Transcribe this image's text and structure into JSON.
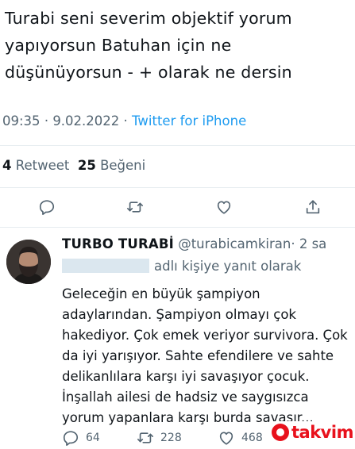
{
  "main_tweet": {
    "text": "Turabi seni severim objektif yorum\nyapıyorsun Batuhan için ne\ndüşünüyorsun - + olarak ne dersin",
    "time": "09:35",
    "date": "9.02.2022",
    "separator": "·",
    "client": "Twitter for iPhone"
  },
  "stats": {
    "retweet_count": "4",
    "retweet_label": "Retweet",
    "like_count": "25",
    "like_label": "Beğeni"
  },
  "actions": {
    "icons": [
      "reply-icon",
      "retweet-icon",
      "like-icon",
      "share-icon"
    ]
  },
  "reply": {
    "name": "TURBO TURABİ",
    "handle": "@turabicamkiran",
    "separator": "·",
    "time": "2 sa",
    "reply_to_suffix": "adlı kişiye yanıt olarak",
    "text": "Geleceğin en büyük şampiyon\nadaylarından. Şampiyon olmayı çok\nhakediyor. Çok emek veriyor survivora. Çok\nda iyi yarışıyor. Sahte efendilere ve sahte\ndelikanlılara karşı iyi savaşıyor çocuk.\nİnşallah ailesi de hadsiz ve saygısızca\nyorum yapanlara karşı burda savaşır...",
    "reply_count": "64",
    "retweet_count": "228",
    "like_count": "468"
  },
  "watermark": {
    "text": "takvim"
  },
  "colors": {
    "text": "#0f1419",
    "muted": "#536471",
    "link": "#1d9bf0",
    "divider": "#e6ecf0",
    "watermark": "#e8111c"
  }
}
